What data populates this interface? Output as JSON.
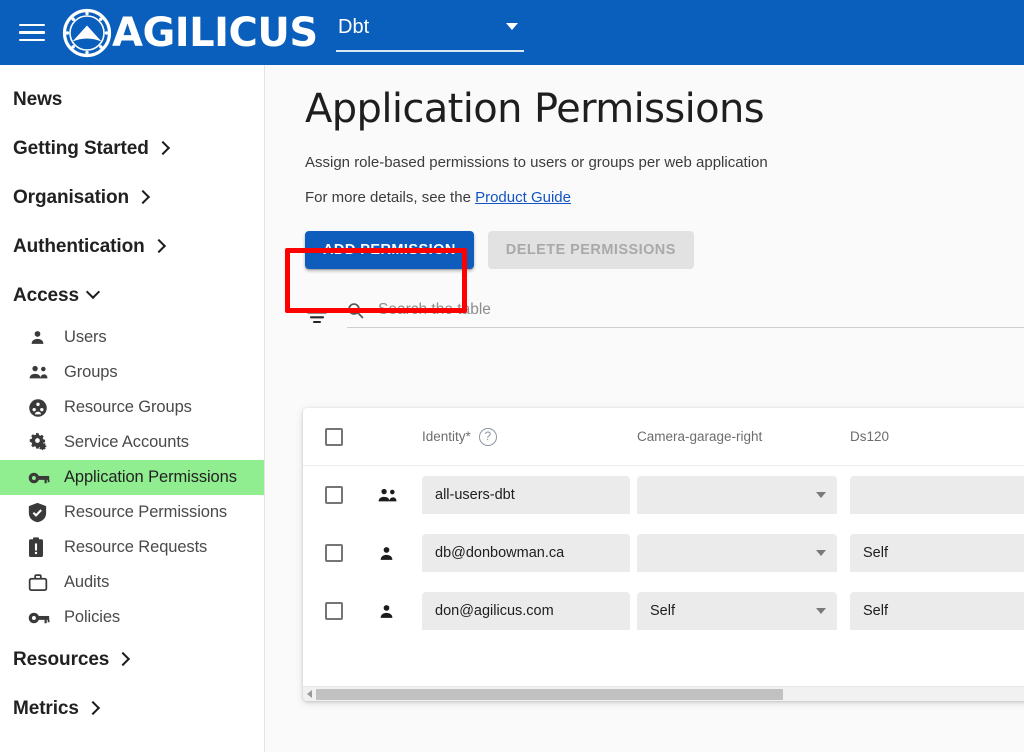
{
  "appbar": {
    "menu_icon": "hamburger-icon",
    "logo_icon": "agilicus-logo-icon",
    "brand": "AGILICUS",
    "org_selector": {
      "value": "Dbt",
      "caret_icon": "chevron-down-icon"
    },
    "bg_color": "#0a5fbd"
  },
  "sidebar": {
    "groups": [
      {
        "label": "News",
        "chevron": null
      },
      {
        "label": "Getting Started",
        "chevron": "chevron-right-icon"
      },
      {
        "label": "Organisation",
        "chevron": "chevron-right-icon"
      },
      {
        "label": "Authentication",
        "chevron": "chevron-right-icon"
      },
      {
        "label": "Access",
        "chevron": "chevron-down-icon"
      }
    ],
    "access_items": [
      {
        "label": "Users",
        "icon": "person-icon",
        "active": false
      },
      {
        "label": "Groups",
        "icon": "people-icon",
        "active": false
      },
      {
        "label": "Resource Groups",
        "icon": "group-circle-icon",
        "active": false
      },
      {
        "label": "Service Accounts",
        "icon": "gears-icon",
        "active": false
      },
      {
        "label": "Application Permissions",
        "icon": "key-icon",
        "active": true
      },
      {
        "label": "Resource Permissions",
        "icon": "shield-check-icon",
        "active": false
      },
      {
        "label": "Resource Requests",
        "icon": "clipboard-alert-icon",
        "active": false
      },
      {
        "label": "Audits",
        "icon": "briefcase-icon",
        "active": false
      },
      {
        "label": "Policies",
        "icon": "key-icon",
        "active": false
      }
    ],
    "footer_groups": [
      {
        "label": "Resources",
        "chevron": "chevron-right-icon"
      },
      {
        "label": "Metrics",
        "chevron": "chevron-right-icon"
      }
    ],
    "active_highlight_color": "#90ee90"
  },
  "main": {
    "title": "Application Permissions",
    "subtitle": "Assign role-based permissions to users or groups per web application",
    "details_prefix": "For more details, see the ",
    "details_link": "Product Guide",
    "buttons": {
      "add_label": "ADD PERMISSION",
      "delete_label": "DELETE PERMISSIONS"
    },
    "annotation": {
      "type": "red-highlight-box",
      "color": "#fd0000",
      "target": "ADD PERMISSION"
    },
    "search": {
      "filter_icon": "filter-list-icon",
      "search_icon": "search-icon",
      "placeholder": "Search the table",
      "value": ""
    }
  },
  "table": {
    "select_all_checkbox": false,
    "columns": [
      {
        "label": "Identity*",
        "help_icon": "help-circle-icon"
      },
      {
        "label": "Camera-garage-right"
      },
      {
        "label": "Ds120"
      }
    ],
    "rows": [
      {
        "checked": false,
        "type_icon": "people-icon",
        "identity": "all-users-dbt",
        "camera_garage_right": "",
        "ds120": ""
      },
      {
        "checked": false,
        "type_icon": "person-icon",
        "identity": "db@donbowman.ca",
        "camera_garage_right": "",
        "ds120": "Self"
      },
      {
        "checked": false,
        "type_icon": "person-icon",
        "identity": "don@agilicus.com",
        "camera_garage_right": "Self",
        "ds120": "Self"
      }
    ],
    "horizontal_scrollbar": {
      "left_arrow_icon": "arrow-left-icon",
      "thumb_fraction": 0.64
    }
  }
}
